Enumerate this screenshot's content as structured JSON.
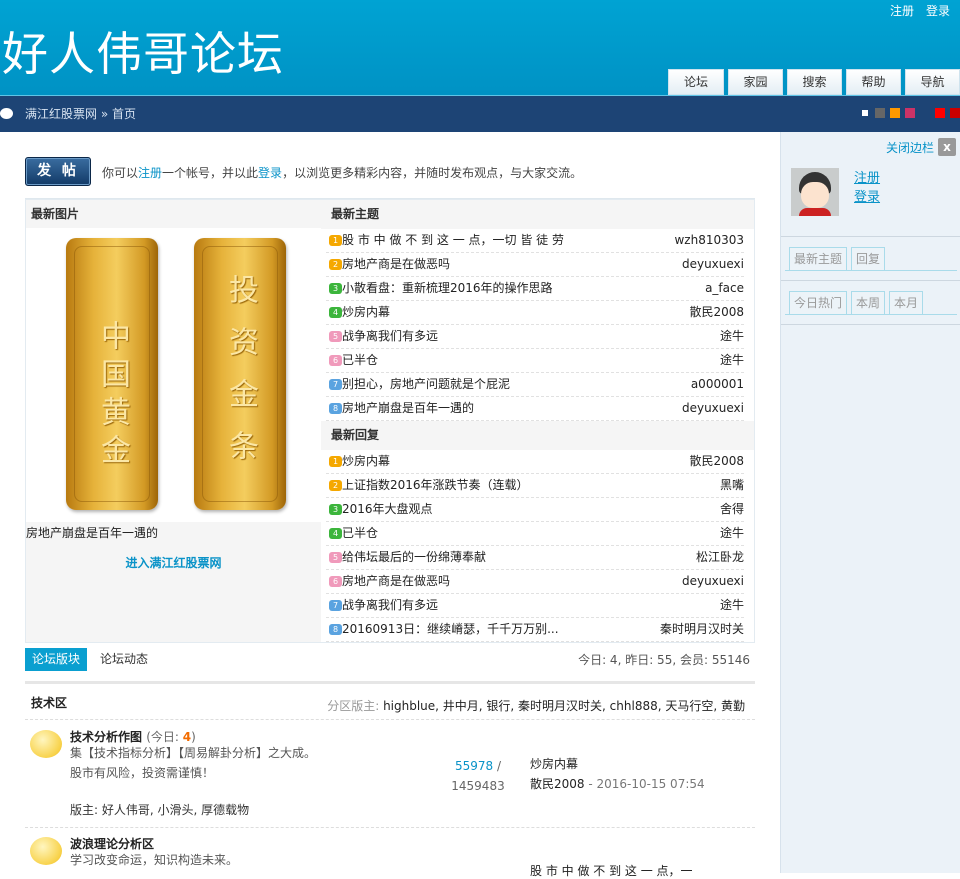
{
  "header": {
    "logo": "好人伟哥论坛",
    "top_links": [
      "注册",
      "登录"
    ],
    "nav": [
      "论坛",
      "家园",
      "搜索",
      "帮助",
      "导航"
    ]
  },
  "breadcrumb": {
    "site": "满江红股票网",
    "sep": "»",
    "page": "首页"
  },
  "colors": {
    "accent": "#0a9fd0",
    "navbar": "#1d4475",
    "swatches": [
      "#1d4475",
      "#666666",
      "#ff9900",
      "#cc3366",
      "#1d4475",
      "#ff0000",
      "#cc0000"
    ]
  },
  "sidebar": {
    "close": "关闭边栏",
    "close_x": "x",
    "register": "注册",
    "login": "登录",
    "tabs1": [
      "最新主题",
      "回复"
    ],
    "tabs2": [
      "今日热门",
      "本周",
      "本月"
    ]
  },
  "post_button": "发 帖",
  "intro": {
    "a": "你可以",
    "register": "注册",
    "b": "一个帐号，并以此",
    "login": "登录",
    "c": "，以浏览更多精彩内容，并随时发布观点，与大家交流。"
  },
  "pictures": {
    "title": "最新图片",
    "bar1": "中国黄金",
    "bar2": "投资金条",
    "caption": "房地产崩盘是百年一遇的",
    "link": "进入满江红股票网"
  },
  "new_threads": {
    "title": "最新主题",
    "items": [
      {
        "t": "股 市 中 做 不 到 这 一 点，一切 皆 徒 劳",
        "a": "wzh810303"
      },
      {
        "t": "房地产商是在做恶吗",
        "a": "deyuxuexi"
      },
      {
        "t": "小散看盘：重新梳理2016年的操作思路",
        "a": "a_face"
      },
      {
        "t": "炒房内幕",
        "a": "散民2008"
      },
      {
        "t": "战争离我们有多远",
        "a": "途牛"
      },
      {
        "t": "已半仓",
        "a": "途牛"
      },
      {
        "t": "别担心，房地产问题就是个屁泥",
        "a": "a000001"
      },
      {
        "t": "房地产崩盘是百年一遇的",
        "a": "deyuxuexi"
      }
    ]
  },
  "new_replies": {
    "title": "最新回复",
    "items": [
      {
        "t": "炒房内幕",
        "a": "散民2008"
      },
      {
        "t": "上证指数2016年涨跌节奏（连载）",
        "a": "黑嘴"
      },
      {
        "t": "2016年大盘观点",
        "a": "舍得"
      },
      {
        "t": "已半仓",
        "a": "途牛"
      },
      {
        "t": "给伟坛最后的一份绵薄奉献",
        "a": "松江卧龙"
      },
      {
        "t": "房地产商是在做恶吗",
        "a": "deyuxuexi"
      },
      {
        "t": "战争离我们有多远",
        "a": "途牛"
      },
      {
        "t": "20160913日：继续嵴瑟，千千万万别...",
        "a": "秦时明月汉时关"
      }
    ]
  },
  "forum_tabs": [
    "论坛版块",
    "论坛动态"
  ],
  "stats": "今日: 4, 昨日: 55, 会员: 55146",
  "group": {
    "name": "技术区",
    "mods_label": "分区版主:",
    "mods": "highblue, 井中月, 银行, 秦时明月汉时关, chhl888, 天马行空, 黄勤"
  },
  "forums": [
    {
      "name": "技术分析作图",
      "today_label": "(今日: ",
      "today": "4",
      "today_end": ")",
      "desc1": "集【技术指标分析】【周易解卦分析】之大成。",
      "desc2": "股市有风险，投资需谨慎！",
      "mods": "版主: 好人伟哥, 小滑头, 厚德载物",
      "threads": "55978",
      "slash": " /",
      "posts": "1459483",
      "last_title": "炒房内幕",
      "last_user": "散民2008",
      "last_time": " - 2016-10-15 07:54"
    },
    {
      "name": "波浪理论分析区",
      "desc1": "学习改变命运，知识构造未来。",
      "last_title": "股 市 中 做 不 到 这 一 点，一"
    }
  ]
}
